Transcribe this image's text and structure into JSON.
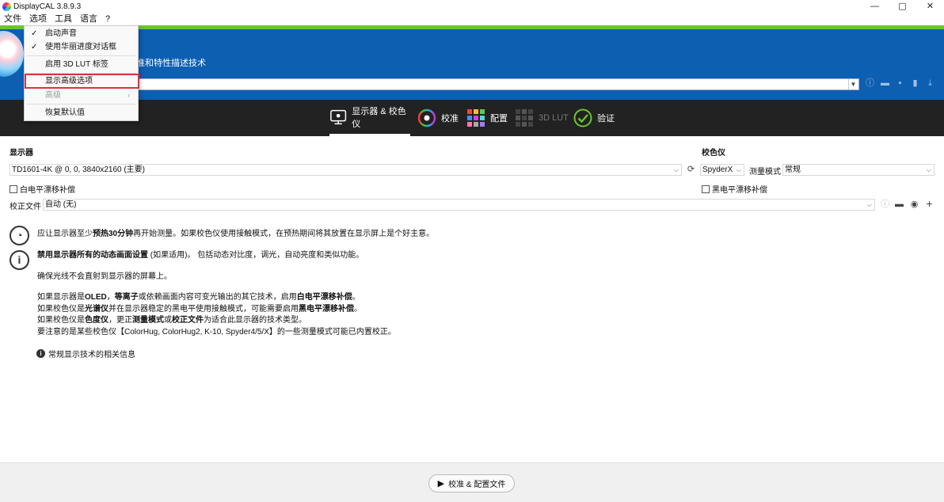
{
  "window": {
    "title": "DisplayCAL 3.8.9.3",
    "minimize": "—",
    "maximize": "▢",
    "close": "✕"
  },
  "menubar": {
    "file": "文件",
    "options": "选项",
    "tools": "工具",
    "language": "语言",
    "help": "?"
  },
  "options_menu": {
    "items": [
      {
        "label": "启动声音",
        "checked": true,
        "check": "✓"
      },
      {
        "label": "使用华丽进度对话框",
        "checked": true,
        "check": "✓"
      },
      {
        "label": "启用 3D LUT 标签",
        "checked": false
      },
      {
        "label": "显示高级选项",
        "checked": false,
        "highlighted": true
      },
      {
        "label": "高级",
        "disabled": true,
        "submenu": "›"
      },
      {
        "label": "恢复默认值",
        "checked": false
      }
    ]
  },
  "banner": {
    "subtitle": "准和特性描述技术"
  },
  "tabs": [
    {
      "label": "显示器 & 校色仪",
      "active": true
    },
    {
      "label": "校准"
    },
    {
      "label": "配置"
    },
    {
      "label": "3D LUT",
      "disabled": true
    },
    {
      "label": "验证"
    }
  ],
  "display": {
    "section_label": "显示器",
    "selected": "TD1601-4K @ 0, 0, 3840x2160 (主要)",
    "white_drift": "白电平漂移补偿"
  },
  "instrument": {
    "section_label": "校色仪",
    "selected": "SpyderX",
    "mode_label": "测量模式",
    "mode_value": "常规",
    "black_drift": "黑电平漂移补偿"
  },
  "correction": {
    "label": "校正文件",
    "value": "自动 (无)"
  },
  "hints": {
    "warmup_pre": "应让显示器至少",
    "warmup_bold": "预热30分钟",
    "warmup_post": "再开始测量。如果校色仪使用接触模式，在预热期间将其放置在显示屏上是个好主意。",
    "dynamic_bold": "禁用显示器所有的动态画面设置",
    "dynamic_post": " (如果适用)。 包括动态对比度，调光，自动亮度和类似功能。",
    "light": "确保光线不会直射到显示器的屏幕上。",
    "oled_1": "如果显示器是",
    "oled_b1": "OLED",
    "oled_2": "，",
    "oled_b2": "等离子",
    "oled_3": "或依赖画面内容可变光输出的其它技术，启用",
    "oled_b3": "白电平漂移补偿",
    "oled_4": "。",
    "spectro_1": "如果校色仪是",
    "spectro_b1": "光谱仪",
    "spectro_2": "并在显示器稳定的黑电平使用接触模式，可能需要启用",
    "spectro_b2": "黑电平漂移补偿",
    "spectro_3": "。",
    "color_1": "如果校色仪是",
    "color_b1": "色度仪",
    "color_2": "，更正",
    "color_b2": "测量模式",
    "color_3": "或",
    "color_b3": "校正文件",
    "color_4": "为适合此显示器的技术类型。",
    "note": "要注意的是某些校色仪【ColorHug, ColorHug2, K-10, Spyder4/5/X】的一些测量模式可能已内置校正。",
    "info_link": "常规显示技术的相关信息"
  },
  "footer": {
    "button": "校准 & 配置文件"
  }
}
